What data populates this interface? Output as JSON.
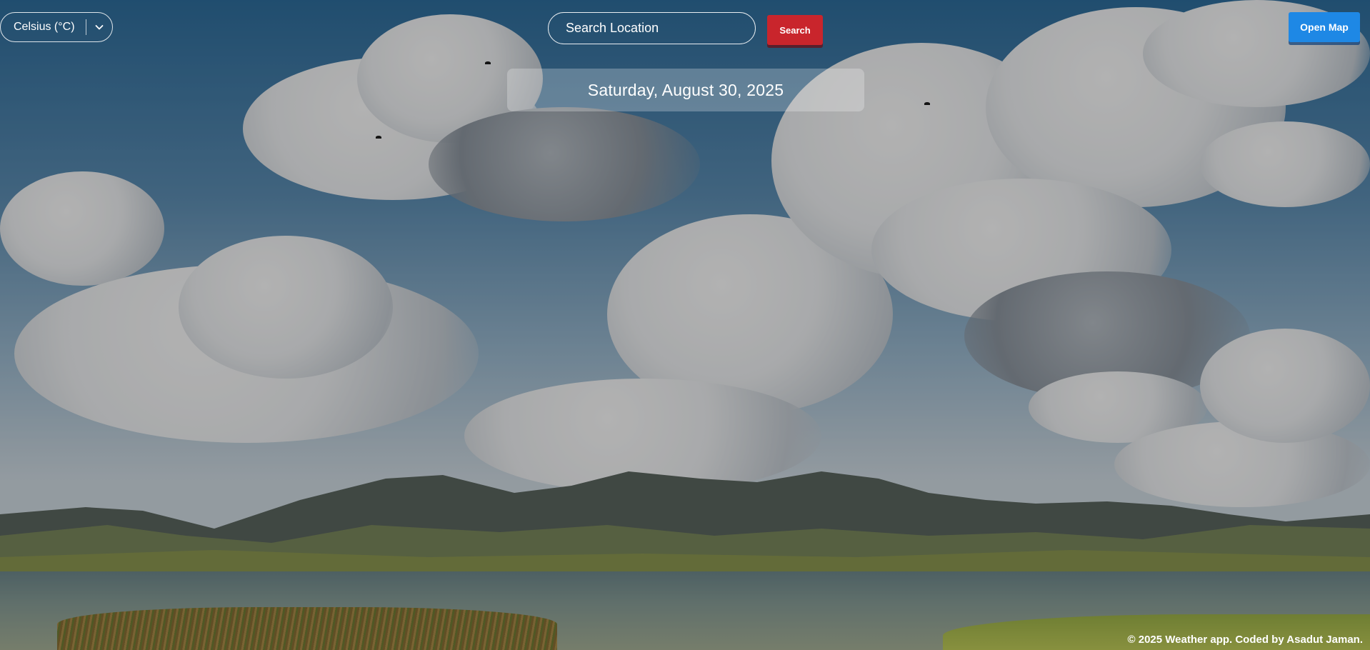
{
  "unit_selector": {
    "selected": "Celsius (°C)",
    "icon": "chevron-down-icon"
  },
  "search": {
    "placeholder": "Search Location",
    "value": "",
    "button_label": "Search"
  },
  "map": {
    "button_label": "Open Map"
  },
  "date_panel": {
    "date": "Saturday, August 30, 2025"
  },
  "footer": {
    "text": "© 2025 Weather app. Coded by Asadut Jaman."
  },
  "colors": {
    "search_button": "#c9252c",
    "map_button": "#1e88e5",
    "text": "#ffffff"
  }
}
